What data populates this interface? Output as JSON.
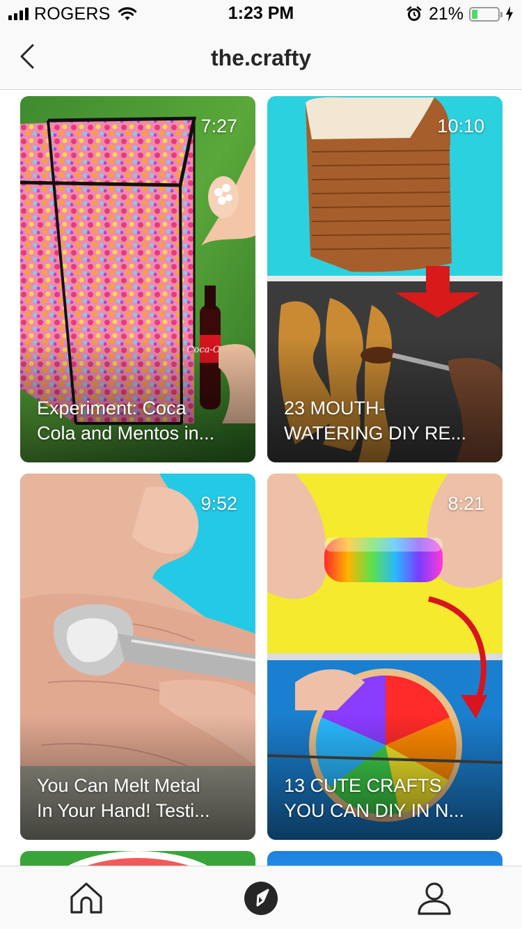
{
  "status_bar": {
    "carrier": "ROGERS",
    "time": "1:23 PM",
    "battery_percent": "21%",
    "battery_level": 0.21,
    "icons": [
      "signal-icon",
      "wifi-icon",
      "alarm-icon",
      "battery-icon",
      "charging-bolt-icon"
    ]
  },
  "nav": {
    "title": "the.crafty",
    "back_icon": "chevron-left-icon"
  },
  "videos": [
    {
      "duration": "7:27",
      "title": "Experiment: Coca\nCola and Mentos in..."
    },
    {
      "duration": "10:10",
      "title": "23 MOUTH-\nWATERING DIY RE..."
    },
    {
      "duration": "9:52",
      "title": "You Can Melt Metal\nIn Your Hand! Testi..."
    },
    {
      "duration": "8:21",
      "title": "13 CUTE CRAFTS\nYOU CAN DIY IN N..."
    }
  ],
  "tab_bar": {
    "tabs": [
      "home-icon",
      "explore-compass-icon",
      "profile-icon"
    ],
    "active": "explore-compass-icon"
  },
  "colors": {
    "bar_background": "#f9f9f9",
    "battery_green": "#4cd964",
    "text_dark": "#262626"
  }
}
